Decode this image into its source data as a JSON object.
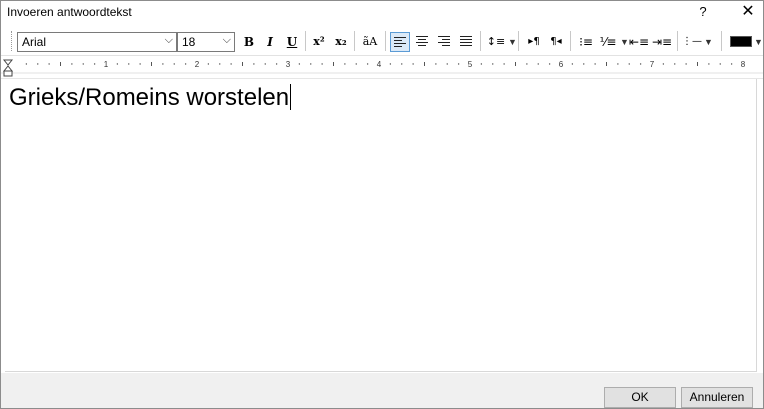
{
  "window": {
    "title": "Invoeren antwoordtekst",
    "help_label": "?",
    "close_label": "✕"
  },
  "toolbar": {
    "font_name": "Arial",
    "font_size": "18",
    "bold": "B",
    "italic": "I",
    "underline": "U",
    "superscript": "x²",
    "subscript": "x₂",
    "case_label": "ãA",
    "color_swatch": "#000000"
  },
  "ruler": {
    "labels": [
      "1",
      "2",
      "3",
      "4",
      "5",
      "6",
      "7",
      "8"
    ]
  },
  "editor": {
    "text": "Grieks/Romeins worstelen"
  },
  "buttons": {
    "ok": "OK",
    "cancel": "Annuleren"
  }
}
